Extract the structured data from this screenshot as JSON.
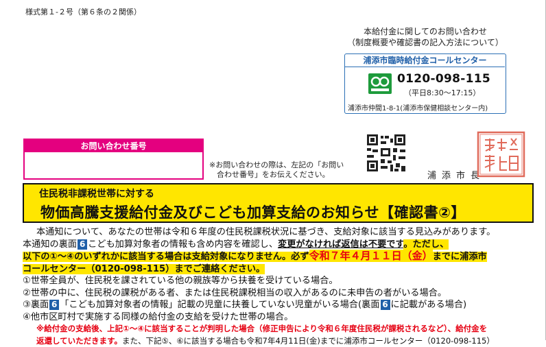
{
  "header": {
    "form_code": "様式第１-２号（第６条の２関係）"
  },
  "inquiry": {
    "line1": "本給付金に関してのお問い合わせ",
    "line2": "（制度概要や確認書の記入方法について）",
    "center_name": "浦添市臨時給付金コールセンター",
    "free_dial_icon": "free-dial-icon",
    "phone": "0120-098-115",
    "hours": "（平日8:30～17:15）",
    "address": "浦添市仲間1-8-1(浦添市保健相談センター内)"
  },
  "inquiry_number": {
    "label": "お問い合わせ番号",
    "value": "",
    "note_line1": "※お問い合わせの際は、左記の「お問い",
    "note_line2": "　合わせ番号」をお伝えください。"
  },
  "issuer": {
    "mayor": "浦添市長"
  },
  "banner": {
    "subtitle": "住民税非課税世帯に対する",
    "title": "物価高騰支援給付金及びこども加算支給のお知らせ【確認書②】"
  },
  "body": {
    "p1": "本通知について、あなたの世帯は令和６年度の住民税課税状況に基づき、支給対象に該当する見込みがあります。",
    "p2a": "本通知の裏面",
    "p2mark": "6",
    "p2b": "こども加算対象者の情報も含め内容を確認し、",
    "p2c": "変更がなければ返信は不要です",
    "p2d": "。ただし、",
    "p3a": "以下の①～④のいずれかに該当する場合は支給対象になりません。必ず",
    "p3date": "令和７年４月１１日（金）",
    "p3b": "までに浦添市",
    "p4": "コールセンター（0120-098-115）までご連絡ください。",
    "items": [
      "①世帯全員が、住民税を課されている他の親族等から扶養を受けている場合。",
      "②世帯の中に、住民税の課税がある者、または住民税課税相当の収入があるのに未申告の者がいる場合。",
      "③裏面",
      "④他市区町村で実施する同様の給付金の支給を受けた世帯の場合。"
    ],
    "item3_mark": "6",
    "item3_rest": "「こども加算対象者の情報」記載の児童に扶養していない児童がいる場合(裏面",
    "item3_mark2": "6",
    "item3_end": "に記載がある場合)",
    "warn1": "※給付金の支給後、上記①～④に該当することが判明した場合（修正申告により令和６年度住民税が課税されるなど）、給付金を",
    "warn2": "返還していただきます。",
    "warn2_rest": "また、下記⑤、⑥に該当する場合も令和7年4月11日(金)までに浦添市コールセンター（0120-098-115）"
  }
}
